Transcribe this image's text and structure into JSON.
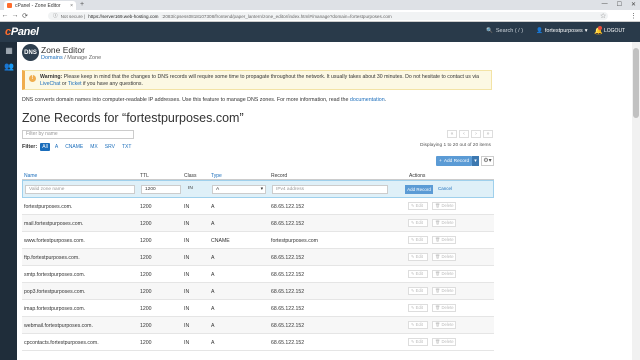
{
  "browser": {
    "tab_title": "cPanel - Zone Editor",
    "tab_close": "×",
    "new_tab": "+",
    "url_prefix": "Not secure |",
    "url_host": "https://server169.web-hosting.com",
    "url_path": ":2083/cpsess0818107308/frontend/paper_lantern/zone_editor/index.html#/manage?domain=fortestpurposes.com",
    "win_min": "—",
    "win_max": "☐",
    "win_close": "✕",
    "back": "←",
    "forward": "→",
    "reload": "⟳",
    "lock_icon": "ⓘ",
    "star_icon": "☆",
    "menu_icon": "⋮"
  },
  "header": {
    "logo_c": "c",
    "logo_rest": "Panel",
    "search_icon": "🔍",
    "search_label": "Search ( / )",
    "user_icon": "👤",
    "username": "fortestpurposes",
    "caret": "▾",
    "bell_icon": "🔔",
    "logout_label": "LOGOUT"
  },
  "sidebar": {
    "grid_icon": "▦",
    "users_icon": "👥"
  },
  "page": {
    "icon_text": "DNS",
    "title": "Zone Editor",
    "breadcrumb_domains": "Domains",
    "breadcrumb_sep": " / ",
    "breadcrumb_current": "Manage Zone"
  },
  "warning": {
    "icon": "!",
    "label": "Warning:",
    "text": " Please keep in mind that the changes to DNS records will require some time to propagate throughout the network. It usually takes about 30 minutes. Do not hesitate to contact us via ",
    "livechat": "LiveChat",
    "or": " or ",
    "ticket": "Ticket",
    "tail": " if you have any questions."
  },
  "description": {
    "text": "DNS converts domain names into computer-readable IP addresses. Use this feature to manage DNS zones. For more information, read the ",
    "link": "documentation",
    "end": "."
  },
  "zone": {
    "title": "Zone Records for “fortestpurposes.com”",
    "filter_placeholder": "Filter by name",
    "filter_label": "Filter:",
    "filters": [
      "All",
      "A",
      "CNAME",
      "MX",
      "SRV",
      "TXT"
    ],
    "displaying": "Displaying 1 to 20 out of 20 items",
    "pager": [
      "«",
      "‹",
      "›",
      "»"
    ],
    "add_record_label": "Add Record",
    "add_caret": "▾",
    "gear_icon": "⚙▾"
  },
  "table": {
    "headers": {
      "name": "Name",
      "ttl": "TTL",
      "class": "Class",
      "type": "Type",
      "record": "Record",
      "actions": "Actions"
    },
    "new_row": {
      "name_placeholder": "Valid zone name",
      "ttl_value": "1200",
      "class_value": "IN",
      "type_value": "A",
      "type_caret": "▾",
      "record_placeholder": "IPv4 address",
      "add_record": "Add Record",
      "cancel": "Cancel"
    },
    "edit_label": "✎ Edit",
    "delete_label": "🗑 Delete",
    "rows": [
      {
        "name": "fortestpurposes.com.",
        "ttl": "1200",
        "class": "IN",
        "type": "A",
        "record": "68.65.122.152"
      },
      {
        "name": "mail.fortestpurposes.com.",
        "ttl": "1200",
        "class": "IN",
        "type": "A",
        "record": "68.65.122.152"
      },
      {
        "name": "www.fortestpurposes.com.",
        "ttl": "1200",
        "class": "IN",
        "type": "CNAME",
        "record": "fortestpurposes.com"
      },
      {
        "name": "ftp.fortestpurposes.com.",
        "ttl": "1200",
        "class": "IN",
        "type": "A",
        "record": "68.65.122.152"
      },
      {
        "name": "smtp.fortestpurposes.com.",
        "ttl": "1200",
        "class": "IN",
        "type": "A",
        "record": "68.65.122.152"
      },
      {
        "name": "pop3.fortestpurposes.com.",
        "ttl": "1200",
        "class": "IN",
        "type": "A",
        "record": "68.65.122.152"
      },
      {
        "name": "imap.fortestpurposes.com.",
        "ttl": "1200",
        "class": "IN",
        "type": "A",
        "record": "68.65.122.152"
      },
      {
        "name": "webmail.fortestpurposes.com.",
        "ttl": "1200",
        "class": "IN",
        "type": "A",
        "record": "68.65.122.152"
      },
      {
        "name": "cpcontacts.fortestpurposes.com.",
        "ttl": "1200",
        "class": "IN",
        "type": "A",
        "record": "68.65.122.152"
      }
    ]
  }
}
